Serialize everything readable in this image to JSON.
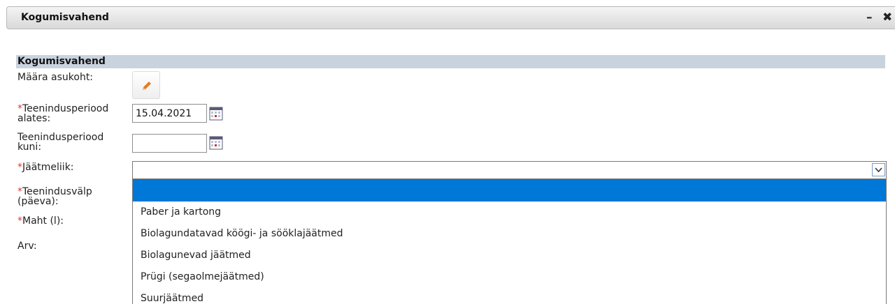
{
  "window": {
    "title": "Kogumisvahend",
    "minimize_glyph": "–",
    "close_glyph": "✖"
  },
  "section": {
    "title": "Kogumisvahend"
  },
  "form": {
    "location": {
      "label": "Määra asukoht:",
      "button_icon": "pencil-icon"
    },
    "period_from": {
      "required_mark": "*",
      "label_line1": "Teenindusperiood",
      "label_line2": "alates:",
      "value": "15.04.2021",
      "calendar_icon": "calendar-icon"
    },
    "period_to": {
      "label_line1": "Teenindusperiood",
      "label_line2": "kuni:",
      "value": "",
      "calendar_icon": "calendar-icon"
    },
    "waste_type": {
      "required_mark": "*",
      "label": "Jäätmeliik:",
      "selected_value": "",
      "options": [
        "",
        "Paber ja kartong",
        "Biolagundatavad köögi- ja sööklajäätmed",
        "Biolagunevad jäätmed",
        "Prügi (segaolmejäätmed)",
        "Suurjäätmed"
      ]
    },
    "service_interval": {
      "required_mark": "*",
      "label_line1": "Teenindusvälp",
      "label_line2": "(päeva):"
    },
    "volume": {
      "required_mark": "*",
      "label": "Maht (l):"
    },
    "count": {
      "label": "Arv:"
    }
  },
  "colors": {
    "section_header_bg": "#c9d3de",
    "required": "#d9392f",
    "highlight": "#0078d7",
    "pencil": "#e87c1e"
  }
}
